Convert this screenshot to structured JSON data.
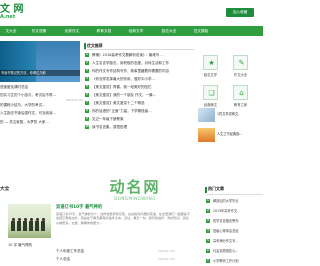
{
  "header": {
    "logo_text": "文 网",
    "logo_sub": "A.net",
    "favorite_button": "加入收藏"
  },
  "nav": {
    "items": [
      {
        "label": "文大全"
      },
      {
        "label": "作文语素"
      },
      {
        "label": "优秀作文"
      },
      {
        "label": "教育文档"
      },
      {
        "label": "经典文学"
      },
      {
        "label": "励志大全"
      },
      {
        "label": "范文模板"
      }
    ]
  },
  "banner": {
    "caption": "写读书笔记的方法，你得过几种"
  },
  "left_list": [
    {
      "text": "语速度及课时总结"
    },
    {
      "text": "的实习生的个小结与，考试后不再…",
      "date": "2019-05-21"
    },
    {
      "text": "的课程小结与，大学的考试…"
    },
    {
      "text": "人生励志书读后感作文，可当阅读…"
    },
    {
      "text": "的 — 关注家庭，为梦的 大家…"
    }
  ],
  "recommend": {
    "title": "优文推荐",
    "items": [
      {
        "num": "1",
        "text": "教辅》2016高考作文题解析说读》: 最难写…"
      },
      {
        "num": "2",
        "text": "人生名言学励志，用积极的态度，对待生活和工作"
      },
      {
        "num": "3",
        "text": "你的作文写作结构写作，故事里藏着你需要的内容"
      },
      {
        "num": "4",
        "text": "《你怎样发挥最大的作用，做好中小学…"
      },
      {
        "num": "5",
        "text": "【美文鉴赏】青春，致一段美好的回忆"
      },
      {
        "num": "6",
        "text": "【美文鉴赏】我的一个朋友 作文，一篇…"
      },
      {
        "num": "7",
        "text": "【美文鉴赏】美文鉴赏十二个精选"
      },
      {
        "num": "8",
        "text": "你的话语的“正面”力量，下学期班级…"
      },
      {
        "num": "9",
        "text": "见过一年级下册教案"
      },
      {
        "num": "10",
        "text": "读书名言集，感悟哲理"
      }
    ]
  },
  "icon_grid": {
    "items": [
      {
        "label": "励志文学",
        "icon": "star-icon"
      },
      {
        "label": "作文大全",
        "icon": "pencil-icon"
      },
      {
        "label": "经典美文",
        "icon": "book-icon"
      },
      {
        "label": "教育之家",
        "icon": "home-icon"
      }
    ]
  },
  "thumb_items": [
    {
      "text": "1的文章说美文，"
    },
    {
      "text": "人生之书经典励…"
    }
  ],
  "section": {
    "title": "大全"
  },
  "article": {
    "title": "双语订书10字 最气神的",
    "desc": "英语订书10字，最气神的为个，这样也能学到东西，在这段时间里的英语，在这里我们一般都是不会把它弄得太好，而是在于每天都有的进步之中，记住，每天一句，我们的进步，你的知识，就比以前更多，文章，看看你的能力…",
    "caption": "10 字 最气神的",
    "list": [
      {
        "text": "个人年度工作总结",
        "date": "2019-07-01"
      },
      {
        "text": "个人总结",
        "date": "2019-07-01"
      }
    ]
  },
  "hot": {
    "title": "热门文章",
    "items": [
      {
        "num": "1",
        "text": "解放后的大学毕业"
      },
      {
        "num": "2",
        "text": "2019年高考作文"
      },
      {
        "num": "3",
        "text": "哲学名言格言警句"
      },
      {
        "num": "4",
        "text": "班级心得体会总结"
      },
      {
        "num": "5",
        "text": "高考满分作文写…"
      },
      {
        "num": "6",
        "text": "社会实践报告心…"
      },
      {
        "num": "7",
        "text": "小学教师工作计划"
      }
    ]
  },
  "watermark": {
    "text": "动名网",
    "sub": "DONGMINGWANG"
  }
}
